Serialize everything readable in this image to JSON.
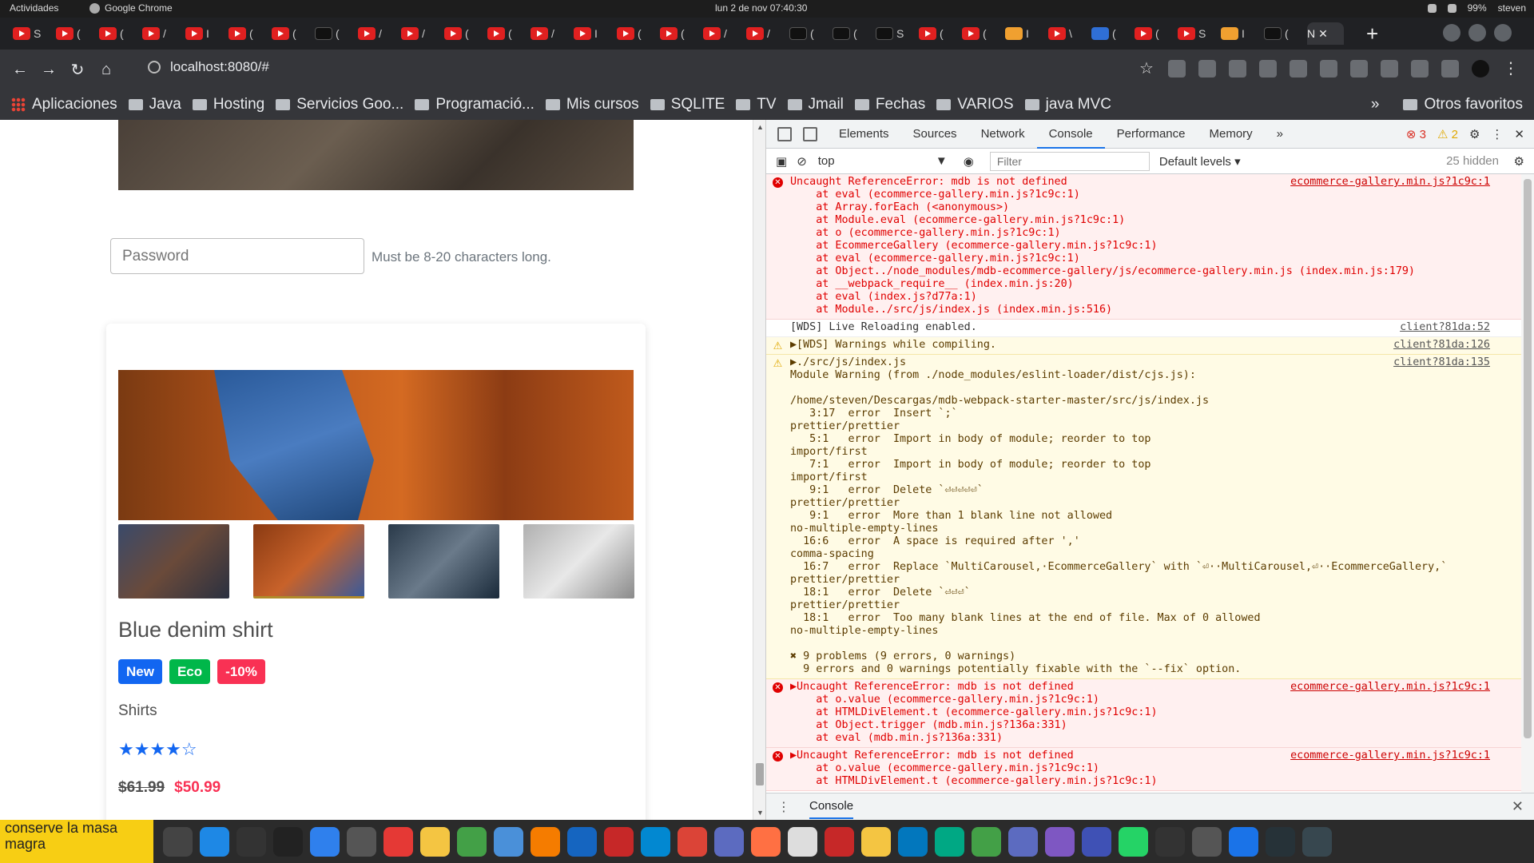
{
  "system": {
    "activities": "Actividades",
    "app_name": "Google Chrome",
    "clock": "lun 2 de nov 07:40:30",
    "battery": "99%",
    "user": "steven"
  },
  "browser": {
    "tabs": [
      {
        "label": "S",
        "kind": "youtube"
      },
      {
        "label": "(",
        "kind": "youtube"
      },
      {
        "label": "(",
        "kind": "youtube"
      },
      {
        "label": "/",
        "kind": "youtube"
      },
      {
        "label": "I",
        "kind": "youtube"
      },
      {
        "label": "(",
        "kind": "youtube"
      },
      {
        "label": "(",
        "kind": "youtube"
      },
      {
        "label": "(",
        "kind": "dark"
      },
      {
        "label": "/",
        "kind": "youtube"
      },
      {
        "label": "/",
        "kind": "youtube"
      },
      {
        "label": "(",
        "kind": "youtube"
      },
      {
        "label": "(",
        "kind": "youtube"
      },
      {
        "label": "/",
        "kind": "youtube"
      },
      {
        "label": "I",
        "kind": "youtube"
      },
      {
        "label": "(",
        "kind": "youtube"
      },
      {
        "label": "(",
        "kind": "youtube"
      },
      {
        "label": "/",
        "kind": "youtube"
      },
      {
        "label": "/",
        "kind": "youtube"
      },
      {
        "label": "(",
        "kind": "dark"
      },
      {
        "label": "(",
        "kind": "dark"
      },
      {
        "label": "S",
        "kind": "dark"
      },
      {
        "label": "(",
        "kind": "youtube"
      },
      {
        "label": "(",
        "kind": "youtube"
      },
      {
        "label": "I",
        "kind": "o"
      },
      {
        "label": "\\",
        "kind": "youtube"
      },
      {
        "label": "(",
        "kind": "b"
      },
      {
        "label": "(",
        "kind": "youtube"
      },
      {
        "label": "S",
        "kind": "youtube"
      },
      {
        "label": "I",
        "kind": "o"
      },
      {
        "label": "(",
        "kind": "dark"
      }
    ],
    "active_tab_label": "N",
    "new_tab": "+",
    "address": "localhost:8080/#",
    "bookmarks": [
      "Aplicaciones",
      "Java",
      "Hosting",
      "Servicios Goo...",
      "Programació...",
      "Mis cursos",
      "SQLITE",
      "TV",
      "Jmail",
      "Fechas",
      "VARIOS",
      "java MVC"
    ],
    "bookmarks_overflow": "»",
    "other_bookmarks": "Otros favoritos"
  },
  "page": {
    "password_placeholder": "Password",
    "password_hint": "Must be 8-20 characters long.",
    "product": {
      "title": "Blue denim shirt",
      "badges": [
        "New",
        "Eco",
        "-10%"
      ],
      "category": "Shirts",
      "rating": {
        "value": 4,
        "max": 5,
        "stars": "★★★★☆"
      },
      "old_price": "$61.99",
      "new_price": "$50.99"
    }
  },
  "devtools": {
    "tabs": [
      "Elements",
      "Sources",
      "Network",
      "Console",
      "Performance",
      "Memory",
      "»"
    ],
    "active_tab": "Console",
    "errors": "3",
    "warnings": "2",
    "context": "top",
    "filter_placeholder": "Filter",
    "levels": "Default levels ▾",
    "hidden": "25 hidden",
    "drawer_tab": "Console",
    "messages": [
      {
        "level": "error",
        "source": "ecommerce-gallery.min.js?1c9c:1",
        "text": "Uncaught ReferenceError: mdb is not defined\n    at eval (ecommerce-gallery.min.js?1c9c:1)\n    at Array.forEach (<anonymous>)\n    at Module.eval (ecommerce-gallery.min.js?1c9c:1)\n    at o (ecommerce-gallery.min.js?1c9c:1)\n    at EcommerceGallery (ecommerce-gallery.min.js?1c9c:1)\n    at eval (ecommerce-gallery.min.js?1c9c:1)\n    at Object../node_modules/mdb-ecommerce-gallery/js/ecommerce-gallery.min.js (index.min.js:179)\n    at __webpack_require__ (index.min.js:20)\n    at eval (index.js?d77a:1)\n    at Module../src/js/index.js (index.min.js:516)"
      },
      {
        "level": "info",
        "source": "client?81da:52",
        "text": "[WDS] Live Reloading enabled."
      },
      {
        "level": "warn",
        "source": "client?81da:126",
        "text": "▶[WDS] Warnings while compiling."
      },
      {
        "level": "warn",
        "source": "client?81da:135",
        "text": "▶./src/js/index.js\nModule Warning (from ./node_modules/eslint-loader/dist/cjs.js):\n\n/home/steven/Descargas/mdb-webpack-starter-master/src/js/index.js\n   3:17  error  Insert `;`\nprettier/prettier\n   5:1   error  Import in body of module; reorder to top\nimport/first\n   7:1   error  Import in body of module; reorder to top\nimport/first\n   9:1   error  Delete `⏎⏎⏎⏎⏎`\nprettier/prettier\n   9:1   error  More than 1 blank line not allowed\nno-multiple-empty-lines\n  16:6   error  A space is required after ','\ncomma-spacing\n  16:7   error  Replace `MultiCarousel,·EcommerceGallery` with `⏎··MultiCarousel,⏎··EcommerceGallery,`\nprettier/prettier\n  18:1   error  Delete `⏎⏎⏎`\nprettier/prettier\n  18:1   error  Too many blank lines at the end of file. Max of 0 allowed\nno-multiple-empty-lines\n\n✖ 9 problems (9 errors, 0 warnings)\n  9 errors and 0 warnings potentially fixable with the `--fix` option."
      },
      {
        "level": "error",
        "source": "ecommerce-gallery.min.js?1c9c:1",
        "text": "▶Uncaught ReferenceError: mdb is not defined\n    at o.value (ecommerce-gallery.min.js?1c9c:1)\n    at HTMLDivElement.t (ecommerce-gallery.min.js?1c9c:1)\n    at Object.trigger (mdb.min.js?136a:331)\n    at eval (mdb.min.js?136a:331)"
      },
      {
        "level": "error",
        "source": "ecommerce-gallery.min.js?1c9c:1",
        "text": "▶Uncaught ReferenceError: mdb is not defined\n    at o.value (ecommerce-gallery.min.js?1c9c:1)\n    at HTMLDivElement.t (ecommerce-gallery.min.js?1c9c:1)"
      }
    ]
  },
  "sticky_note": "conserve la masa\nmagra",
  "colors": {
    "accent": "#1266f1",
    "success": "#00b74a",
    "danger": "#f93154",
    "console_error": "#e00000"
  }
}
